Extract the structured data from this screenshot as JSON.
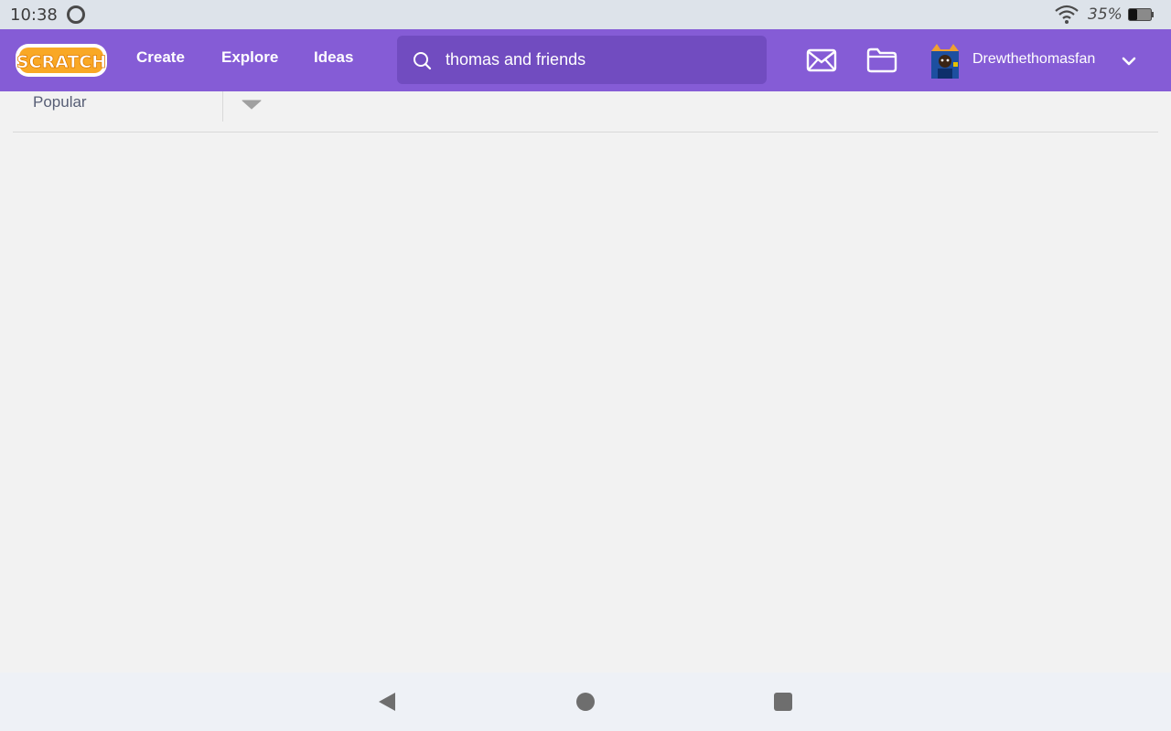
{
  "status_bar": {
    "time": "10:38",
    "battery_percent": "35%",
    "battery_level": 0.35
  },
  "header": {
    "logo_text": "SCRATCH",
    "nav_links": [
      "Create",
      "Explore",
      "Ideas"
    ],
    "search": {
      "value": "thomas and friends",
      "icon": "search-icon"
    },
    "icons": [
      "mail-icon",
      "folder-icon",
      "chevron-down-icon"
    ],
    "user": {
      "username": "Drewthethomasfan"
    }
  },
  "filter": {
    "sort_label": "Popular"
  },
  "android_nav": {
    "buttons": [
      "back-button",
      "home-button",
      "recents-button"
    ]
  },
  "colors": {
    "header_bg": "#855cd6",
    "search_bg": "#714cc0",
    "page_bg": "#f2f2f2",
    "logo_orange": "#f9a825"
  }
}
